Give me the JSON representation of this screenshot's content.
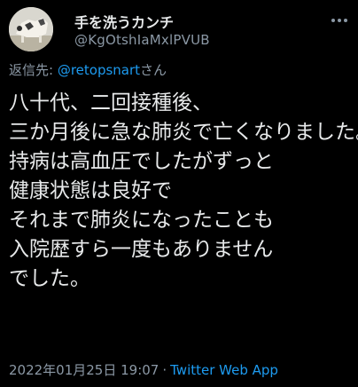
{
  "tweet": {
    "display_name": "手を洗うカンチ",
    "handle": "@KgOtshIaMxlPVUB",
    "reply": {
      "prefix": "返信先: ",
      "mention": "@retopsnart",
      "suffix": "さん"
    },
    "body_lines": [
      "八十代、二回接種後、",
      "三か月後に急な肺炎で亡くなりました。",
      "持病は高血圧でしたがずっと",
      "健康状態は良好で",
      "それまで肺炎になったことも",
      "入院歴すら一度もありません",
      "でした。"
    ],
    "timestamp": "2022年01月25日 19:07",
    "separator": "·",
    "source_app": "Twitter Web App"
  },
  "colors": {
    "background": "#000000",
    "primary_text": "#e7e9ea",
    "secondary_text": "#8b98a5",
    "accent": "#1d9bf0"
  },
  "icons": {
    "avatar": "avatar-photo",
    "more": "more-options-icon"
  }
}
